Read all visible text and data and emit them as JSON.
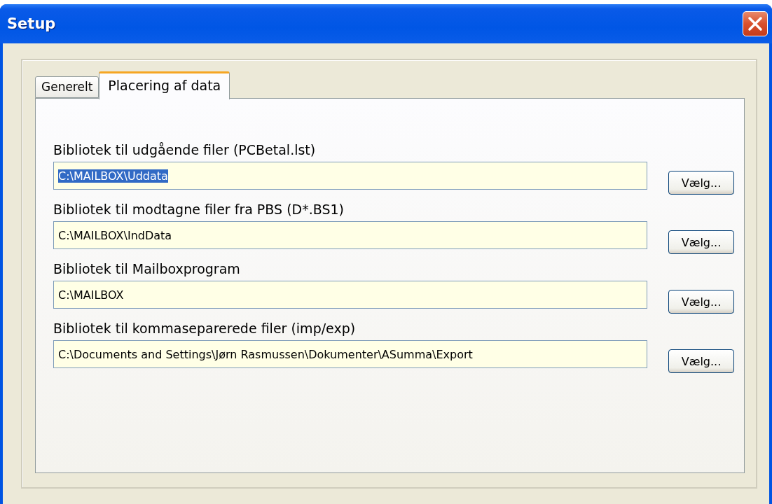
{
  "window": {
    "title": "Setup"
  },
  "tabs": [
    {
      "label": "Generelt",
      "selected": false
    },
    {
      "label": "Placering af data",
      "selected": true
    }
  ],
  "folders": [
    {
      "label": "Bibliotek til udgående filer (PCBetal.lst)",
      "value": "C:\\MAILBOX\\Uddata",
      "text_selected": true,
      "button": "Vælg..."
    },
    {
      "label": "Bibliotek til modtagne filer fra PBS (D*.BS1)",
      "value": "C:\\MAILBOX\\IndData",
      "text_selected": false,
      "button": "Vælg..."
    },
    {
      "label": "Bibliotek til Mailboxprogram",
      "value": "C:\\MAILBOX",
      "text_selected": false,
      "button": "Vælg..."
    },
    {
      "label": "Bibliotek til kommaseparerede filer (imp/exp)",
      "value": "C:\\Documents and Settings\\Jørn Rasmussen\\Dokumenter\\ASumma\\Export",
      "text_selected": false,
      "button": "Vælg..."
    }
  ]
}
